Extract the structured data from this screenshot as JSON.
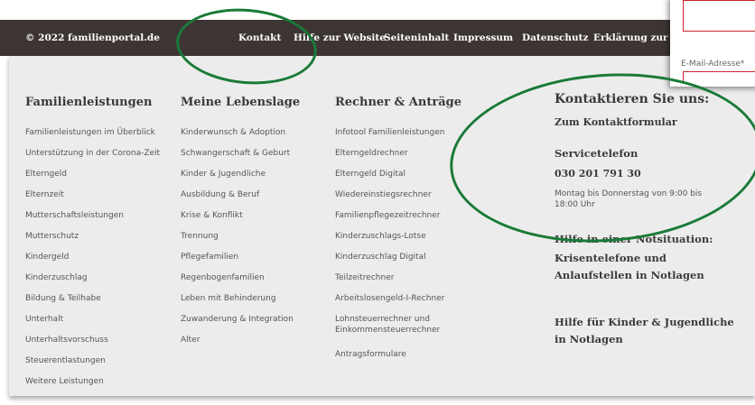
{
  "topbar": {
    "copyright": "© 2022 familienportal.de",
    "links": [
      "Kontakt",
      "Hilfe zur Website",
      "Seiteninhalt",
      "Impressum",
      "Datenschutz",
      "Erklärung zur Ba"
    ]
  },
  "columns": [
    {
      "heading": "Familienleistungen",
      "links": [
        "Familienleistungen im Überblick",
        "Unterstützung in der Corona-Zeit",
        "Elterngeld",
        "Elternzeit",
        "Mutterschaftsleistungen",
        "Mutterschutz",
        "Kindergeld",
        "Kinderzuschlag",
        "Bildung & Teilhabe",
        "Unterhalt",
        "Unterhaltsvorschuss",
        "Steuerentlastungen",
        "Weitere Leistungen"
      ]
    },
    {
      "heading": "Meine Lebenslage",
      "links": [
        "Kinderwunsch & Adoption",
        "Schwangerschaft & Geburt",
        "Kinder & Jugendliche",
        "Ausbildung & Beruf",
        "Krise & Konflikt",
        "Trennung",
        "Pflegefamilien",
        "Regenbogenfamilien",
        "Leben mit Behinderung",
        "Zuwanderung & Integration",
        "Alter"
      ]
    },
    {
      "heading": "Rechner & Anträge",
      "links": [
        "Infotool Familienleistungen",
        "Elterngeldrechner",
        "Elterngeld Digital",
        "Wiedereinstiegsrechner",
        "Familienpflegezeitrechner",
        "Kinderzuschlags-Lotse",
        "Kinderzuschlag Digital",
        "Teilzeitrechner",
        "Arbeitslosengeld-I-Rechner",
        "Lohnsteuerrechner und Einkommensteuerrechner",
        "Antragsformulare"
      ]
    }
  ],
  "contact": {
    "title": "Kontaktieren Sie uns:",
    "form_link": "Zum Kontaktformular",
    "service_label": "Servicetelefon",
    "phone": "030 201 791 30",
    "hours": "Montag bis Donnerstag von 9:00 bis 18:00 Uhr",
    "help_emergency": "Hilfe in einer Notsituation:",
    "crisis_link": "Krisentelefone und Anlaufstellen in Notlagen",
    "children_link": "Hilfe für Kinder & Jugendliche in Notlagen"
  },
  "popup": {
    "email_label": "E-Mail-Adresse*"
  },
  "colors": {
    "topbar": "#3d3533",
    "footer_bg": "#ececec",
    "highlight": "#1a7a38",
    "error_border": "#c9262c"
  }
}
